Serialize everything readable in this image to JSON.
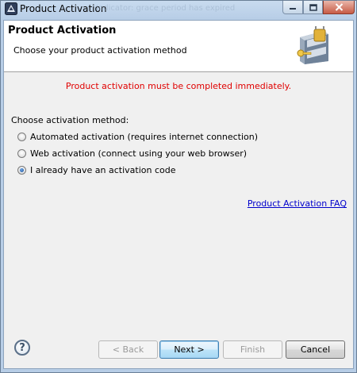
{
  "window": {
    "title": "Product Activation",
    "background_title_text": "Indicator: grace period has expired"
  },
  "banner": {
    "title": "Product Activation",
    "subtitle": "Choose your product activation method",
    "icon": "cabinet-lock-key-icon"
  },
  "message": {
    "text": "Product activation must be completed immediately.",
    "color": "#e00000"
  },
  "method": {
    "label": "Choose activation method:",
    "options": [
      {
        "label": "Automated activation (requires internet connection)",
        "checked": false
      },
      {
        "label": "Web activation (connect using your web browser)",
        "checked": false
      },
      {
        "label": "I already have an activation code",
        "checked": true
      }
    ]
  },
  "faq_link": "Product Activation FAQ",
  "footer": {
    "help": "?",
    "back": "< Back",
    "next": "Next >",
    "finish": "Finish",
    "cancel": "Cancel"
  }
}
